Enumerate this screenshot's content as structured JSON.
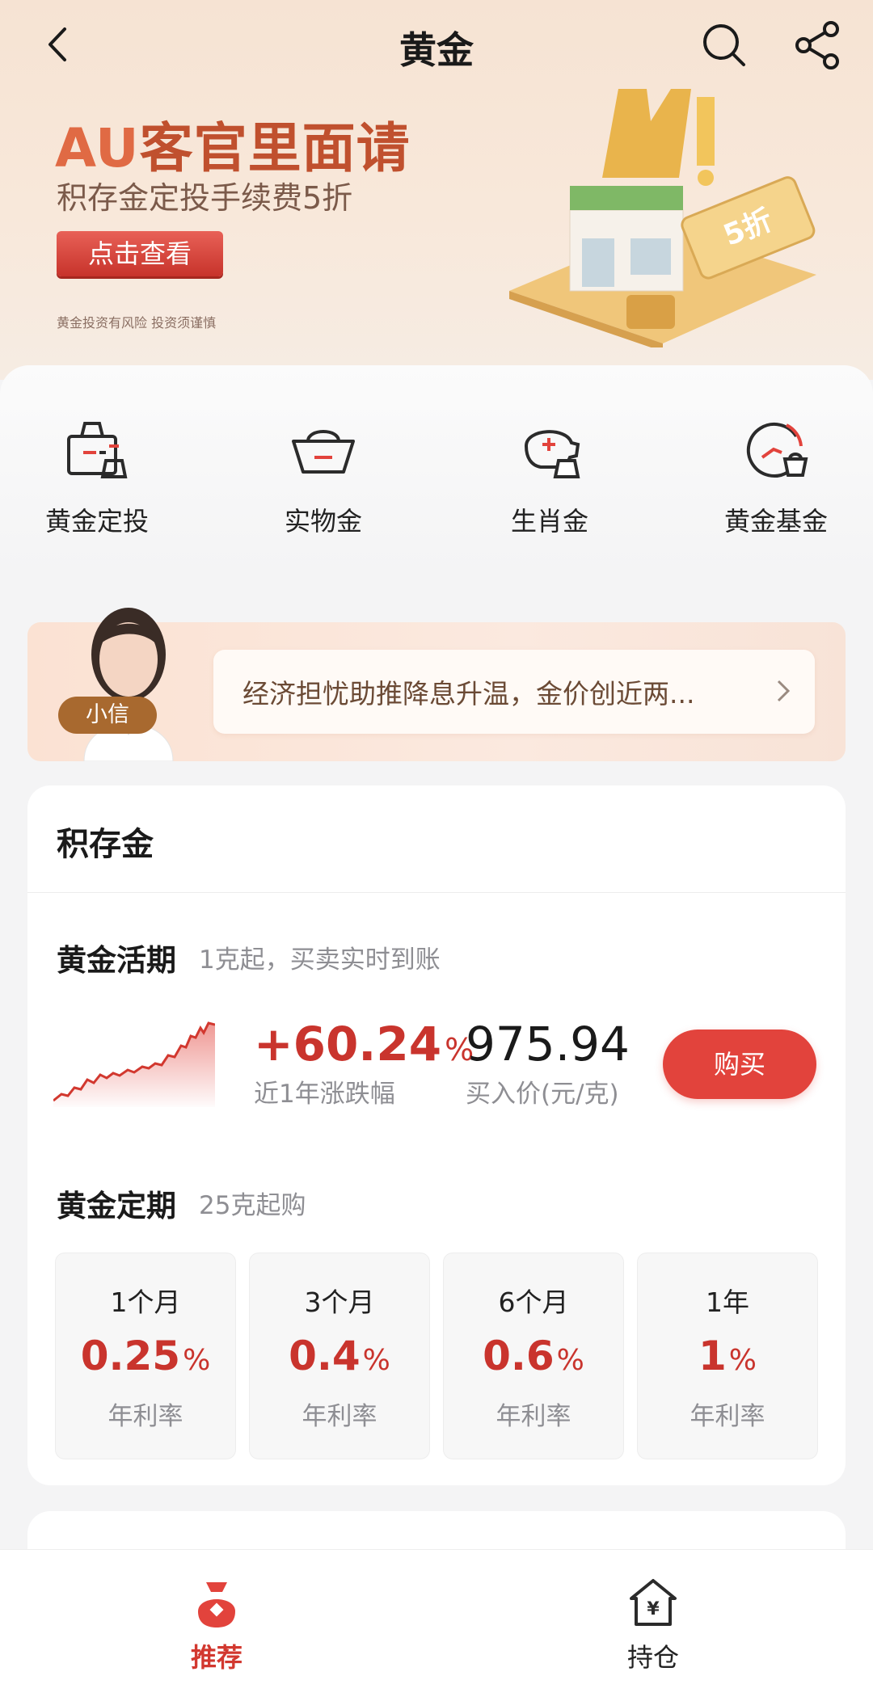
{
  "nav": {
    "title": "黄金",
    "back_icon": "chevron-left-icon",
    "search_icon": "search-icon",
    "share_icon": "share-icon"
  },
  "banner": {
    "headline_prefix": "AU",
    "headline_rest": "客官里面请",
    "subtitle": "积存金定投手续费5折",
    "cta_label": "点击查看",
    "risk_note": "黄金投资有风险 投资须谨慎"
  },
  "quick_menu": [
    {
      "label": "黄金定投",
      "icon": "bag-icon"
    },
    {
      "label": "实物金",
      "icon": "gold-ingot-icon"
    },
    {
      "label": "生肖金",
      "icon": "piggy-bank-icon"
    },
    {
      "label": "黄金基金",
      "icon": "fund-chart-icon"
    }
  ],
  "assistant": {
    "name": "小信",
    "message": "经济担忧助推降息升温，金价创近两..."
  },
  "jicunjin": {
    "title": "积存金",
    "demand": {
      "title": "黄金活期",
      "subtitle": "1克起，买卖实时到账",
      "change": "+60.24",
      "change_unit": "%",
      "change_label": "近1年涨跌幅",
      "price": "975.94",
      "price_label": "买入价(元/克)",
      "buy_label": "购买"
    },
    "fixed": {
      "title": "黄金定期",
      "subtitle": "25克起购",
      "terms": [
        {
          "name": "1个月",
          "rate": "0.25",
          "unit": "%",
          "label": "年利率"
        },
        {
          "name": "3个月",
          "rate": "0.4",
          "unit": "%",
          "label": "年利率"
        },
        {
          "name": "6个月",
          "rate": "0.6",
          "unit": "%",
          "label": "年利率"
        },
        {
          "name": "1年",
          "rate": "1",
          "unit": "%",
          "label": "年利率"
        }
      ]
    }
  },
  "tabbar": {
    "items": [
      {
        "label": "推荐",
        "icon": "recommend-icon",
        "active": true
      },
      {
        "label": "持仓",
        "icon": "holdings-house-icon",
        "active": false
      }
    ]
  },
  "colors": {
    "accent_red": "#e2433c",
    "rate_red": "#c9342d",
    "banner_orange": "#e06a44"
  }
}
